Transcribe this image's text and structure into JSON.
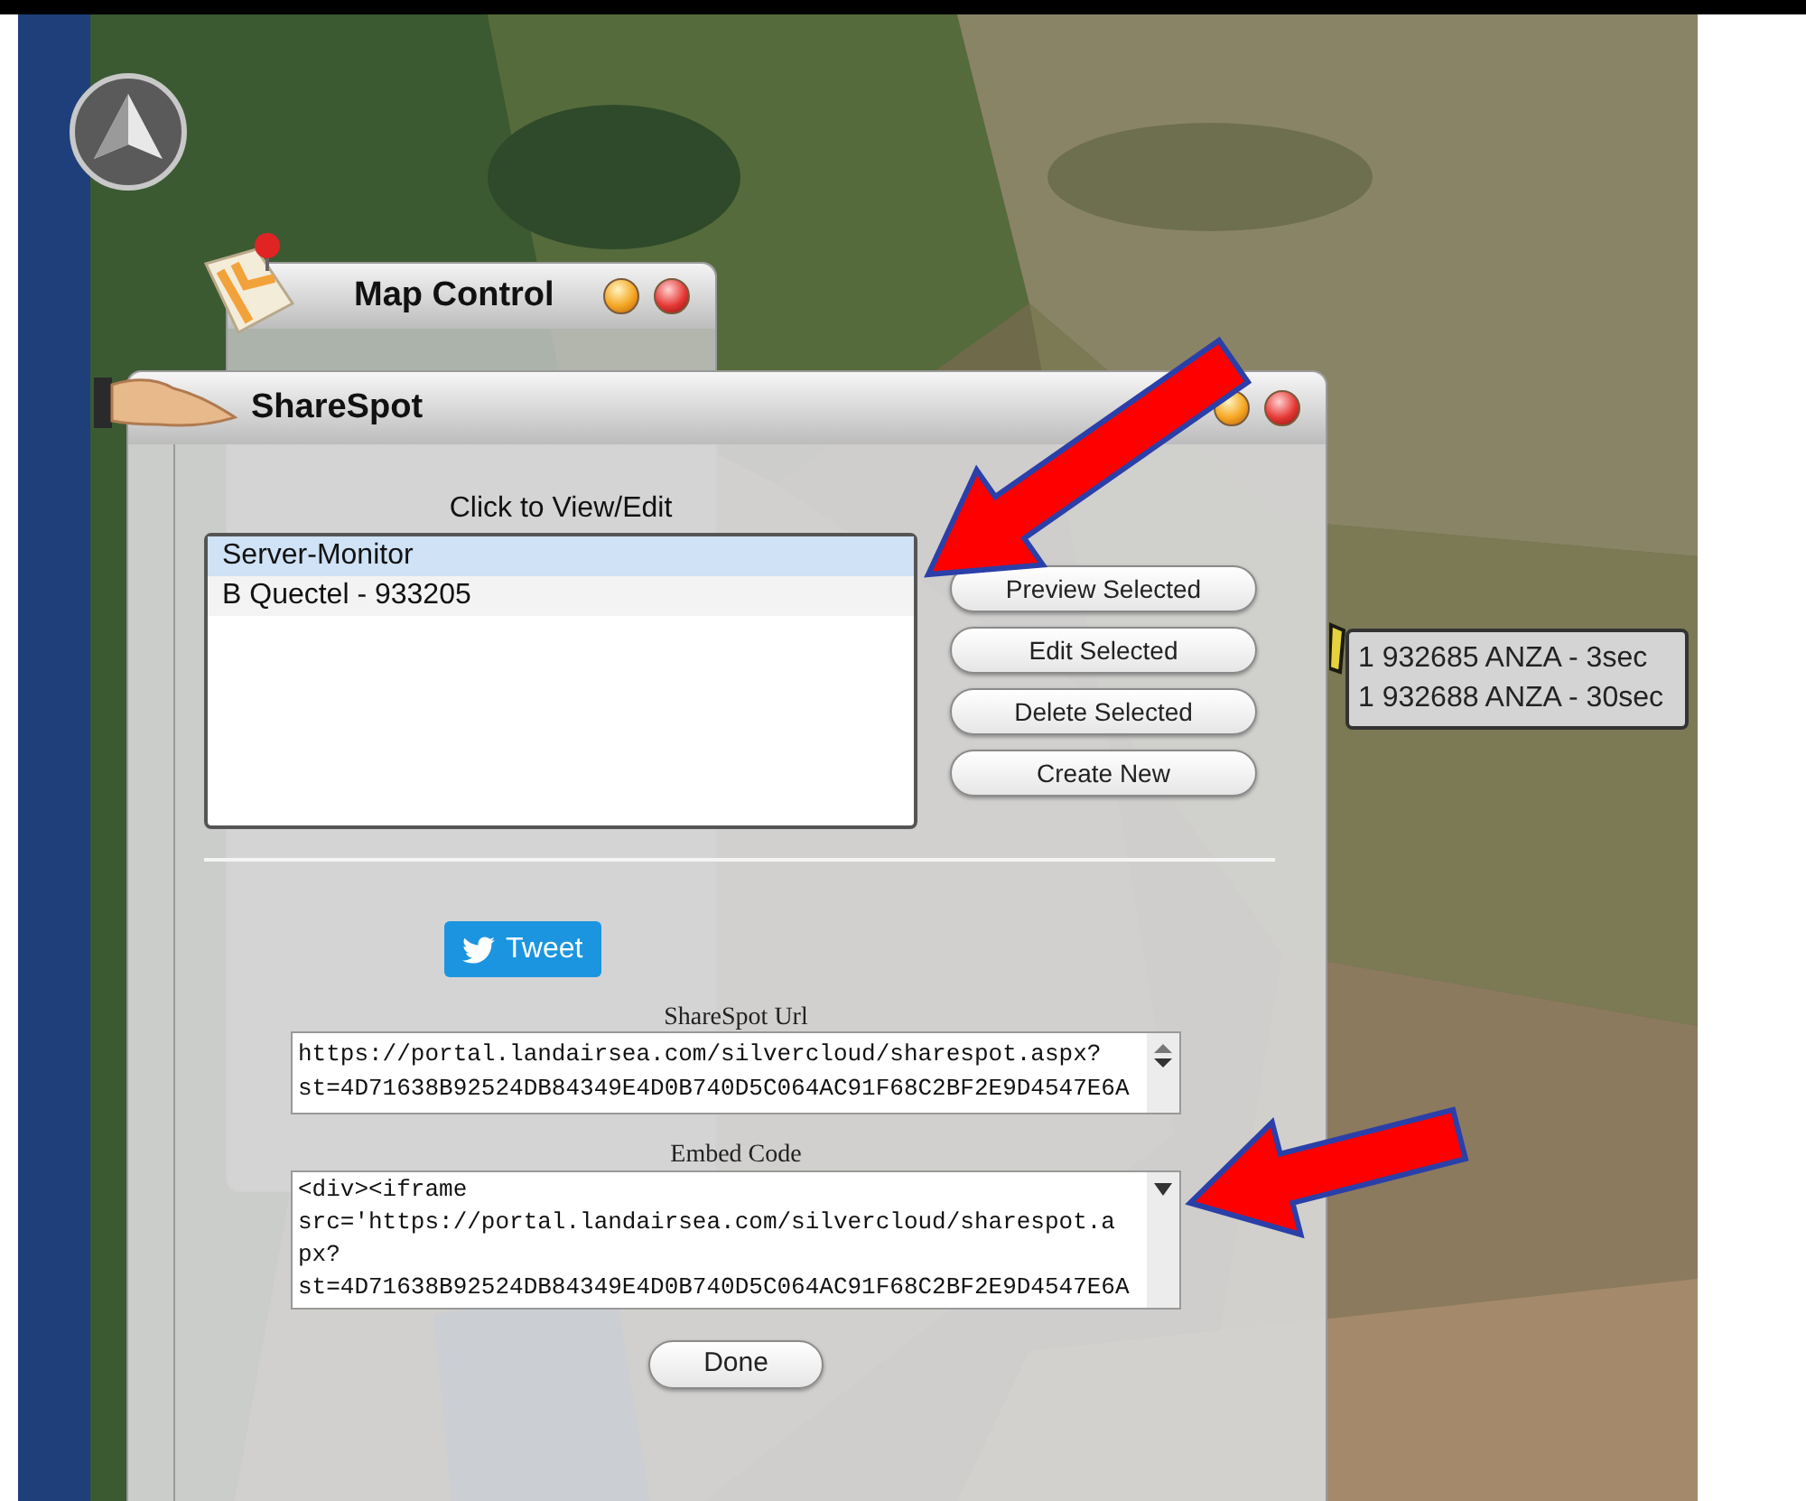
{
  "map_control_window": {
    "title": "Map Control"
  },
  "marker_label": {
    "lines": [
      "1 932685 ANZA - 3sec",
      "1 932688 ANZA - 30sec"
    ]
  },
  "sharespot_window": {
    "title": "ShareSpot",
    "list_label": "Click to View/Edit",
    "list_items": [
      {
        "label": "Server-Monitor",
        "selected": true
      },
      {
        "label": "B Quectel - 933205",
        "selected": false
      }
    ],
    "actions": [
      "Preview Selected",
      "Edit Selected",
      "Delete Selected",
      "Create New"
    ],
    "tweet_button": "Tweet",
    "url": {
      "label": "ShareSpot Url",
      "lines": [
        "https://portal.landairsea.com/silvercloud/sharespot.aspx?",
        "st=4D71638B92524DB84349E4D0B740D5C064AC91F68C2BF2E9D4547E6A"
      ]
    },
    "embed": {
      "label": "Embed Code",
      "lines": [
        "<div><iframe",
        "src='https://portal.landairsea.com/silvercloud/sharespot.a",
        "px?",
        "st=4D71638B92524DB84349E4D0B740D5C064AC91F68C2BF2E9D4547E6A"
      ]
    },
    "done_button": "Done"
  }
}
